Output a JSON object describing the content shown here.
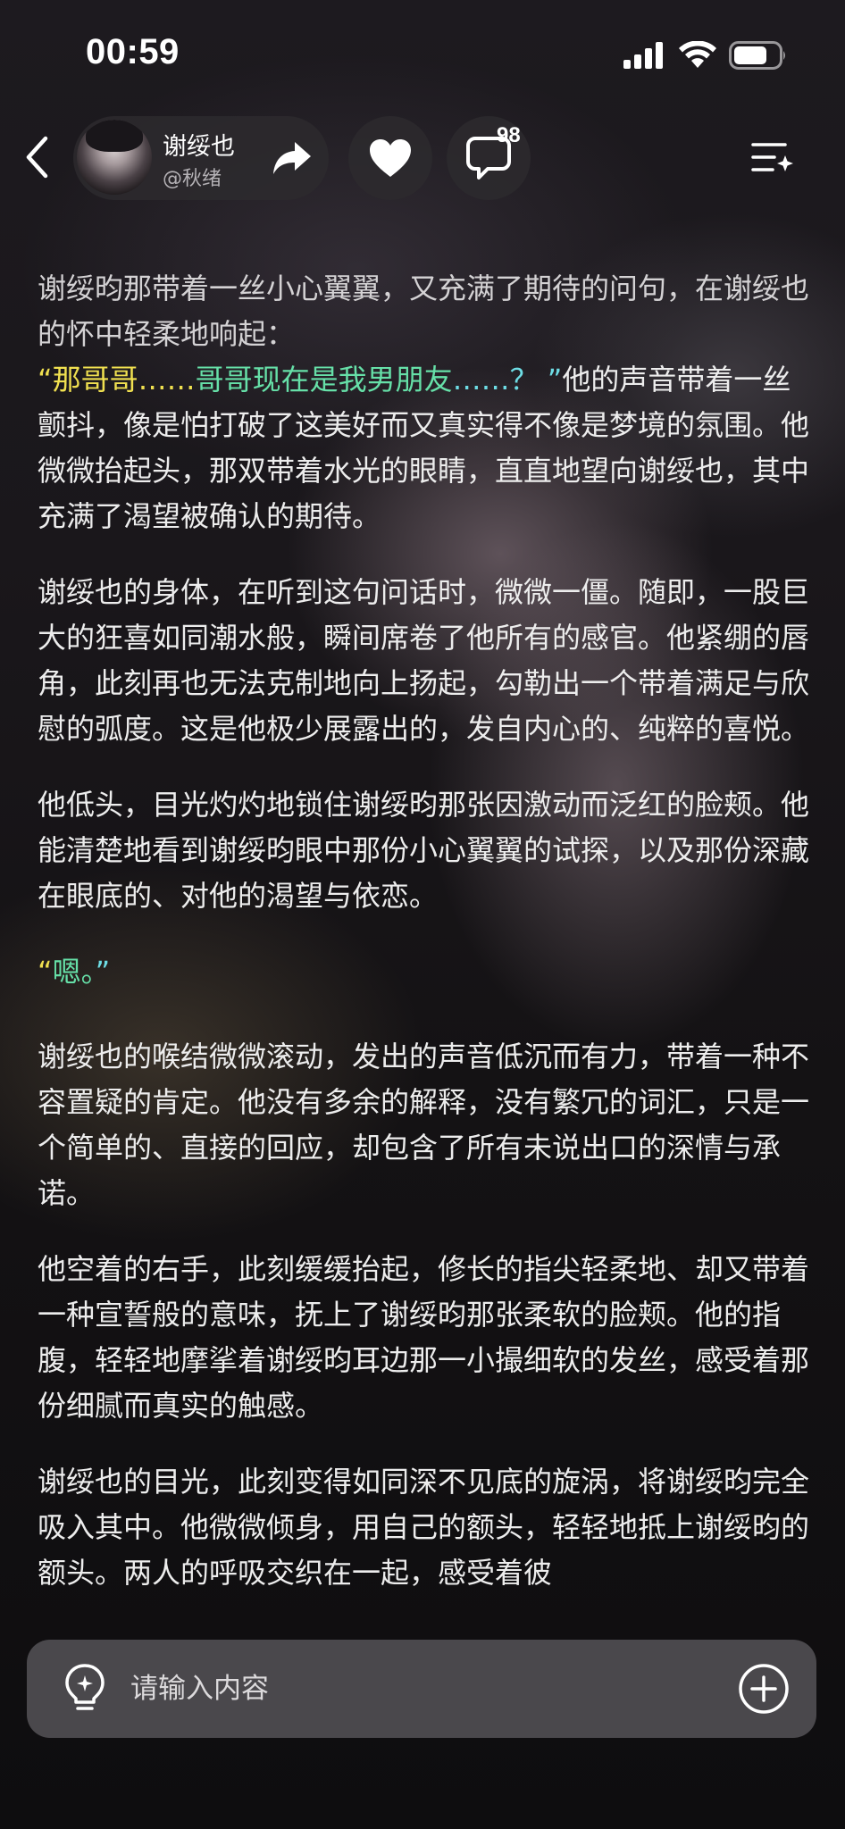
{
  "status_bar": {
    "time": "00:59"
  },
  "header": {
    "character_name": "谢绥也",
    "author": "@秋绪",
    "comment_count": "98"
  },
  "icons": {
    "back": "chevron-left-icon",
    "share": "share-arrow-icon",
    "like": "heart-icon",
    "comment": "comment-bubble-icon",
    "menu": "menu-list-icon",
    "hint": "lightbulb-icon",
    "add": "plus-circle-icon"
  },
  "colors": {
    "quote_yellow": "#f0e050",
    "quote_green": "#66e0a8",
    "quote_cyan": "#6edde5"
  },
  "story": {
    "p1": "谢绥昀那带着一丝小心翼翼，又充满了期待的问句，在谢绥也的怀中轻柔地响起：",
    "p2_quote_open": "“那哥哥……",
    "p2_quote_mid": "哥哥现在是我男朋友",
    "p2_quote_end": "……？ ”",
    "p2_rest": "他的声音带着一丝颤抖，像是怕打破了这美好而又真实得不像是梦境的氛围。他微微抬起头，那双带着水光的眼睛，直直地望向谢绥也，其中充满了渴望被确认的期待。",
    "p3": "谢绥也的身体，在听到这句问话时，微微一僵。随即，一股巨大的狂喜如同潮水般，瞬间席卷了他所有的感官。他紧绷的唇角，此刻再也无法克制地向上扬起，勾勒出一个带着满足与欣慰的弧度。这是他极少展露出的，发自内心的、纯粹的喜悦。",
    "p4": "他低头，目光灼灼地锁住谢绥昀那张因激动而泛红的脸颊。他能清楚地看到谢绥昀眼中那份小心翼翼的试探，以及那份深藏在眼底的、对他的渴望与依恋。",
    "p5_open": "“",
    "p5_word": "嗯。",
    "p5_close": "”",
    "p6": "谢绥也的喉结微微滚动，发出的声音低沉而有力，带着一种不容置疑的肯定。他没有多余的解释，没有繁冗的词汇，只是一个简单的、直接的回应，却包含了所有未说出口的深情与承诺。",
    "p7": "他空着的右手，此刻缓缓抬起，修长的指尖轻柔地、却又带着一种宣誓般的意味，抚上了谢绥昀那张柔软的脸颊。他的指腹，轻轻地摩挲着谢绥昀耳边那一小撮细软的发丝，感受着那份细腻而真实的触感。",
    "p8": "谢绥也的目光，此刻变得如同深不见底的旋涡，将谢绥昀完全吸入其中。他微微倾身，用自己的额头，轻轻地抵上谢绥昀的额头。两人的呼吸交织在一起，感受着彼"
  },
  "input": {
    "placeholder": "请输入内容"
  }
}
